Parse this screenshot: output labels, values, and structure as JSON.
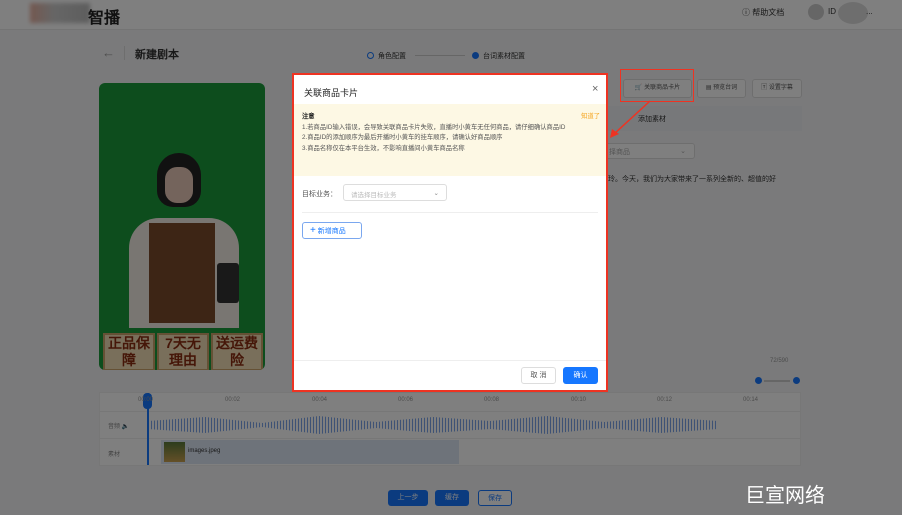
{
  "header": {
    "logo_text": "智播",
    "help": "帮助文档",
    "user_id": "ID",
    "more": "..."
  },
  "page": {
    "title": "新建剧本",
    "steps": [
      "角色配置",
      "台词素材配置"
    ]
  },
  "toolbar": {
    "link_product": "关联商品卡片",
    "preview_script": "预览台词",
    "subtitle": "设置字幕",
    "add_material": "添加素材",
    "product_select": "择商品",
    "script_text": "玲。今天，我们为大家带来了一系列全新的、超值的好",
    "char_count": "72/590"
  },
  "video": {
    "badges": [
      "正品保障",
      "7天无理由",
      "送运费险"
    ]
  },
  "timeline": {
    "ticks": [
      "00:00",
      "00:02",
      "00:04",
      "00:06",
      "00:08",
      "00:10",
      "00:12",
      "00:14"
    ],
    "tracks": {
      "audio": "音频",
      "material": "素材"
    },
    "clip_name": "images.jpeg"
  },
  "footer": {
    "prev": "上一步",
    "cache": "缓存",
    "save": "保存"
  },
  "modal": {
    "title": "关联商品卡片",
    "notice_title": "注意",
    "dismiss": "知道了",
    "notes": [
      "1.若商品ID输入错误，会导致关联商品卡片失败，直播时小黄车无任何商品，请仔细确认商品ID",
      "2.商品ID的添加顺序为最后开播时小黄车的挂车顺序，请确认好商品顺序",
      "3.商品名称仅在本平台生效，不影响直播间小黄车商品名称"
    ],
    "target_label": "目标业务：",
    "target_placeholder": "请选择目标业务",
    "add_product": "新增商品",
    "cancel": "取 消",
    "confirm": "确认"
  },
  "watermark": "巨宣网络",
  "colors": {
    "accent": "#1677ff",
    "highlight": "#ee3322",
    "notice_bg": "#fdf8e4",
    "dismiss": "#f5a623"
  }
}
